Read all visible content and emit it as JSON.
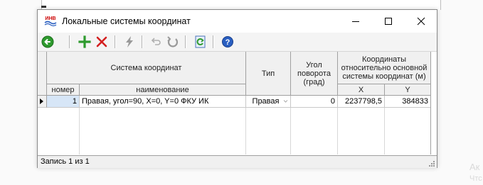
{
  "window": {
    "title": "Локальные системы координат",
    "icon_text": "ИНВ",
    "minimize_icon": "minimize-icon",
    "maximize_icon": "maximize-icon",
    "close_icon": "close-icon"
  },
  "toolbar": {
    "buttons": [
      {
        "name": "back-button",
        "icon": "back-arrow-icon",
        "enabled": true
      },
      {
        "name": "add-button",
        "icon": "plus-icon",
        "enabled": true
      },
      {
        "name": "delete-button",
        "icon": "cross-icon",
        "enabled": true
      },
      {
        "name": "lightning-button",
        "icon": "lightning-icon",
        "enabled": false
      },
      {
        "name": "undo-button",
        "icon": "undo-icon",
        "enabled": false
      },
      {
        "name": "redo-button",
        "icon": "redo-icon",
        "enabled": false
      },
      {
        "name": "refresh-button",
        "icon": "refresh-icon",
        "enabled": true
      },
      {
        "name": "help-button",
        "icon": "help-icon",
        "enabled": true
      }
    ]
  },
  "table": {
    "group_header": "Система координат",
    "col_number": "номер",
    "col_name": "наименование",
    "col_type": "Тип",
    "col_angle": "Угол поворота (град)",
    "coords_header": "Координаты относительно основной системы координат (м)",
    "col_x": "X",
    "col_y": "Y",
    "rows": [
      {
        "number": "1",
        "name": "Правая, угол=90, X=0, Y=0 ФКУ ИК",
        "type": "Правая",
        "angle": "0",
        "x": "2237798,5",
        "y": "384833"
      }
    ]
  },
  "status": {
    "text": "Запись 1 из 1"
  },
  "background": {
    "watermark_1": "Ак",
    "watermark_2": "Чтс"
  },
  "colors": {
    "accent_green": "#2e9a2e",
    "delete_red": "#d42020",
    "help_blue": "#2a5fc1",
    "selected_number_bg": "#d7e6f7"
  }
}
